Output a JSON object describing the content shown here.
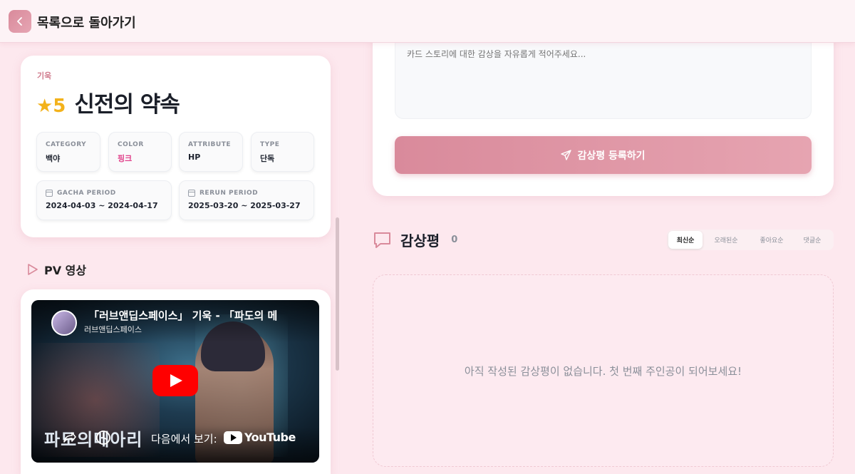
{
  "header": {
    "back_label": "목록으로 돌아가기"
  },
  "card": {
    "character": "기욱",
    "rarity": "★5",
    "title": "신전의 약속",
    "meta": [
      {
        "label": "CATEGORY",
        "value": "백야",
        "color": "#1f2430"
      },
      {
        "label": "COLOR",
        "value": "핑크",
        "color": "#e0408a"
      },
      {
        "label": "ATTRIBUTE",
        "value": "HP",
        "color": "#1f2430"
      },
      {
        "label": "TYPE",
        "value": "단독",
        "color": "#1f2430"
      }
    ],
    "gacha_period": {
      "label": "GACHA PERIOD",
      "value": "2024-04-03 ~ 2024-04-17"
    },
    "rerun_period": {
      "label": "RERUN PERIOD",
      "value": "2025-03-20 ~ 2025-03-27"
    }
  },
  "pv": {
    "section_title": "PV 영상",
    "video_title": "「러브앤딥스페이스」 기욱 - 「파도의 메",
    "channel": "러브앤딥스페이스",
    "watch_on": "다음에서 보기:",
    "youtube": "YouTube",
    "logo_text": "파도의메아리"
  },
  "review_form": {
    "placeholder": "카드 스토리에 대한 감상을 자유롭게 적어주세요...",
    "submit_label": "감상평 등록하기"
  },
  "reviews": {
    "title": "감상평",
    "count": "0",
    "sort_tabs": [
      "최신순",
      "오래된순",
      "좋아요순",
      "댓글순"
    ],
    "active_tab": "최신순",
    "empty_text": "아직 작성된 감상평이 없습니다. 첫 번째 주인공이 되어보세요!"
  },
  "colors": {
    "accent": "#d98a9b",
    "background": "#fde8ee",
    "rarity": "#f3b21b"
  }
}
